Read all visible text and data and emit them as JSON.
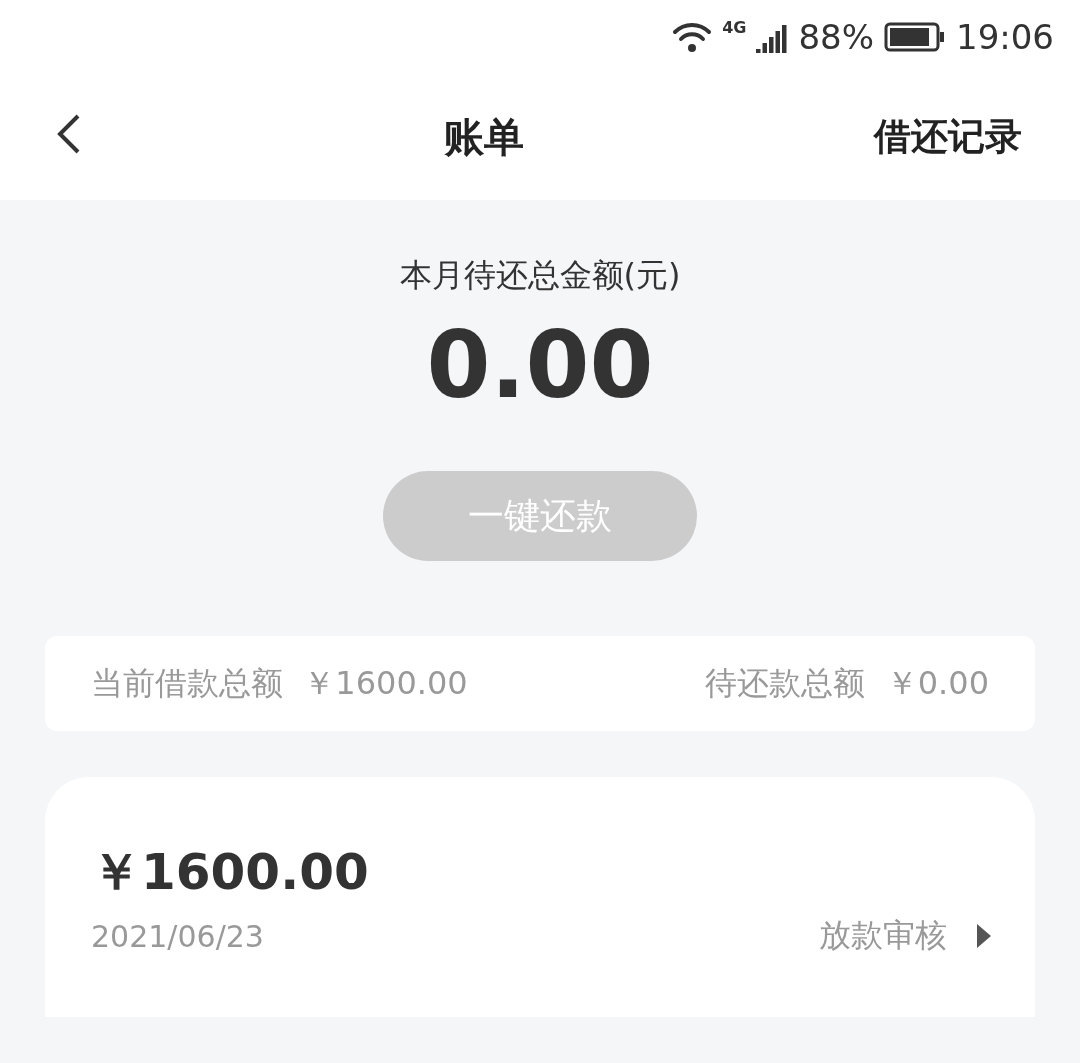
{
  "status_bar": {
    "network": "4G",
    "battery": "88%",
    "time": "19:06"
  },
  "header": {
    "title": "账单",
    "action": "借还记录"
  },
  "summary": {
    "label": "本月待还总金额(元)",
    "amount": "0.00",
    "button": {
      "label": "一键还款",
      "disabled": true
    }
  },
  "totals": [
    {
      "label": "当前借款总额",
      "value": "￥1600.00"
    },
    {
      "label": "待还款总额",
      "value": "￥0.00"
    }
  ],
  "loans": [
    {
      "amount": "￥1600.00",
      "date": "2021/06/23",
      "status": "放款审核"
    }
  ]
}
